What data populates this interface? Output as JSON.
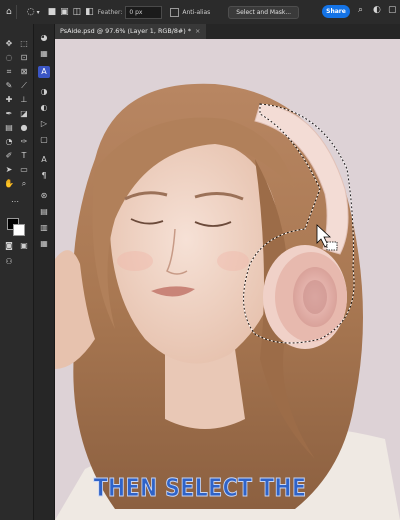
{
  "options_bar": {
    "feather_label": "Feather:",
    "feather_value": "0 px",
    "anti_alias_label": "Anti-alias",
    "select_mask_label": "Select and Mask...",
    "share_label": "Share"
  },
  "document_tab": {
    "title": "PsAide.psd @ 97.6% (Layer 1, RGB/8#) *",
    "close": "×"
  },
  "icons": {
    "home": "home-icon",
    "lasso": "lasso-icon",
    "search": "search-icon",
    "settings": "gear-icon"
  },
  "colors": {
    "accent": "#1473e6",
    "panel_bg": "#2b2b2b",
    "canvas_bg": "#ddd2d6",
    "caption_color": "#2f63c8"
  },
  "caption": "THEN SELECT THE"
}
